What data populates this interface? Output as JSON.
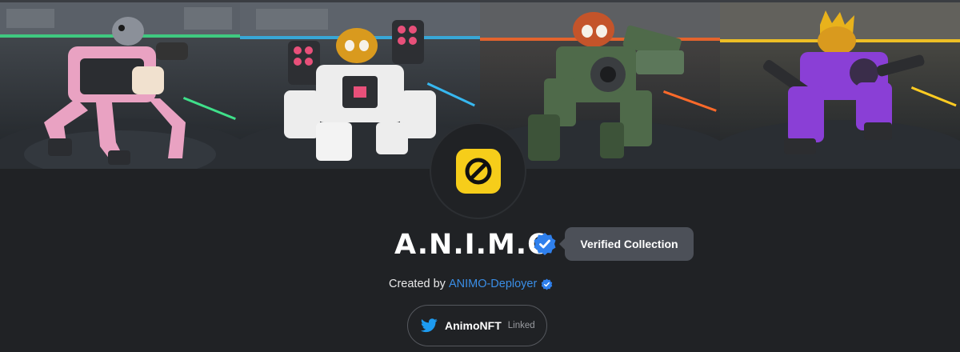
{
  "banner": {
    "panels": [
      {
        "robot": "pink-pigeon-robot",
        "accent": "#e9a2c2",
        "glow": "#3fe08a"
      },
      {
        "robot": "white-cat-robot",
        "accent": "#ededed",
        "glow": "#37b8f0"
      },
      {
        "robot": "green-redpanda-robot",
        "accent": "#4f6a4a",
        "glow": "#ff6a2a"
      },
      {
        "robot": "purple-dragon-robot",
        "accent": "#8a3fd6",
        "glow": "#ffcc22"
      }
    ]
  },
  "collection": {
    "logo_color": "#f6cd1a",
    "name": "A.N.I.M.O",
    "verified_tooltip": "Verified Collection",
    "badge_color": "#2f80ed"
  },
  "creator": {
    "prefix": "Created by",
    "name": "ANIMO-Deployer"
  },
  "social": {
    "icon": "twitter-icon",
    "handle": "AnimoNFT",
    "status": "Linked"
  }
}
